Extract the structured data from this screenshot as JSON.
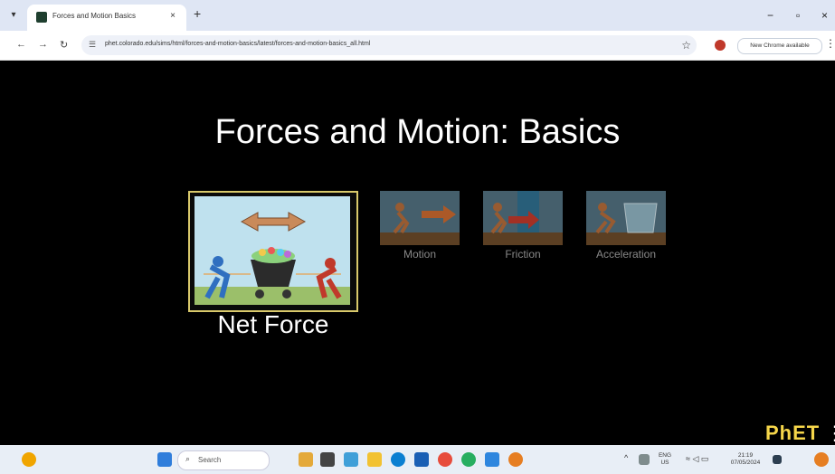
{
  "browser": {
    "tab_title": "Forces and Motion Basics",
    "new_tab": "+",
    "close_tab": "×",
    "url": "phet.colorado.edu/sims/html/forces-and-motion-basics/latest/forces-and-motion-basics_all.html",
    "update_label": "New Chrome available",
    "window_minimize": "−",
    "window_restore": "▫",
    "window_close": "×"
  },
  "sim": {
    "title": "Forces and Motion: Basics",
    "screens": [
      {
        "label": "Net Force",
        "selected": true
      },
      {
        "label": "Motion",
        "selected": false
      },
      {
        "label": "Friction",
        "selected": false
      },
      {
        "label": "Acceleration",
        "selected": false
      }
    ],
    "logo": "PhET"
  },
  "taskbar": {
    "search_placeholder": "Search",
    "language": "ENG",
    "region": "US",
    "time": "21:19",
    "date": "07/05/2024"
  },
  "colors": {
    "tabstrip_bg": "#dfe6f4",
    "sim_bg": "#000000",
    "selected_border": "#d9c96b",
    "phet_logo": "#f6d64a",
    "taskbar_bg": "#e8eef6"
  }
}
